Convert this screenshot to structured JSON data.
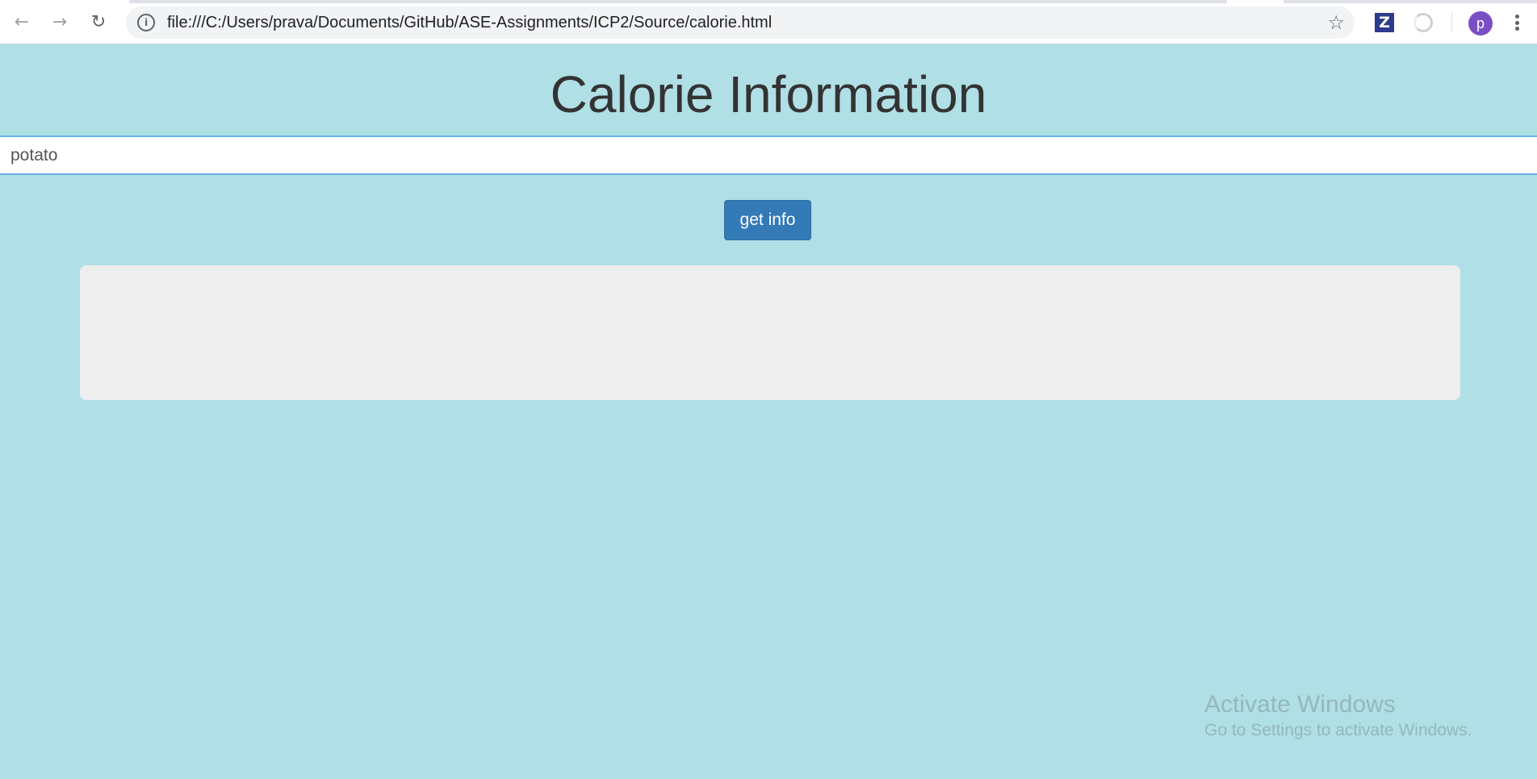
{
  "browser": {
    "url": "file:///C:/Users/prava/Documents/GitHub/ASE-Assignments/ICP2/Source/calorie.html",
    "avatar_initial": "p",
    "extension_z_label": "Z"
  },
  "page": {
    "title": "Calorie Information",
    "search_value": "potato",
    "button_label": "get info"
  },
  "watermark": {
    "title": "Activate Windows",
    "subtitle": "Go to Settings to activate Windows."
  },
  "colors": {
    "page_background": "#b0dfe5",
    "button_primary": "#337ab7",
    "panel_background": "#eeeeee",
    "avatar": "#7b4fc4"
  }
}
